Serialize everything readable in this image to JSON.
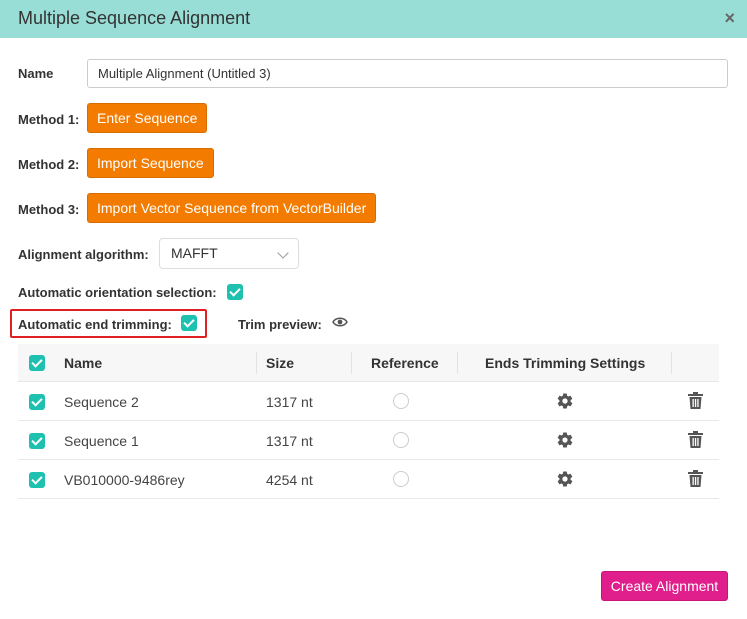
{
  "dialog": {
    "title": "Multiple Sequence Alignment",
    "close_symbol": "×"
  },
  "form": {
    "name_label": "Name",
    "name_value": "Multiple Alignment (Untitled 3)",
    "method1_label": "Method 1:",
    "method1_button": "Enter Sequence",
    "method2_label": "Method 2:",
    "method2_button": "Import Sequence",
    "method3_label": "Method 3:",
    "method3_button": "Import Vector Sequence from VectorBuilder",
    "algorithm_label": "Alignment algorithm:",
    "algorithm_value": "MAFFT",
    "orientation_label": "Automatic orientation selection:",
    "trimming_label": "Automatic end trimming:",
    "trim_preview_label": "Trim preview:"
  },
  "table": {
    "headers": {
      "name": "Name",
      "size": "Size",
      "reference": "Reference",
      "trimming": "Ends Trimming Settings"
    },
    "rows": [
      {
        "name": "Sequence 2",
        "size": "1317 nt"
      },
      {
        "name": "Sequence 1",
        "size": "1317 nt"
      },
      {
        "name": "VB010000-9486rey",
        "size": "4254 nt"
      }
    ]
  },
  "footer": {
    "create_button": "Create Alignment"
  },
  "colors": {
    "header_bg": "#98ddd6",
    "orange_button": "#f27b00",
    "checkbox": "#1ec0b0",
    "create_button": "#e01e8c",
    "highlight": "#e02020"
  },
  "icons": [
    "close-icon",
    "chevron-down-icon",
    "eye-icon",
    "gear-icon",
    "trash-icon",
    "checkbox-checked-icon"
  ]
}
